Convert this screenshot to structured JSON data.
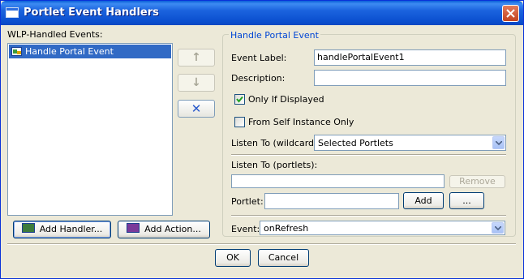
{
  "window": {
    "title": "Portlet Event Handlers"
  },
  "left": {
    "label": "WLP-Handled Events:",
    "events": [
      "Handle Portal Event"
    ],
    "add_handler": "Add Handler...",
    "add_action": "Add Action..."
  },
  "middle": {
    "up_icon": "up-arrow-icon",
    "down_icon": "down-arrow-icon",
    "delete_icon": "delete-x-icon"
  },
  "group": {
    "title": "Handle Portal Event",
    "event_label_label": "Event Label:",
    "event_label_value": "handlePortalEvent1",
    "description_label": "Description:",
    "description_value": "",
    "only_if_displayed": {
      "label": "Only If Displayed",
      "checked": true
    },
    "from_self": {
      "label": "From Self Instance Only",
      "checked": false
    },
    "listen_wildcard_label": "Listen To (wildcard):",
    "listen_wildcard_value": "Selected Portlets",
    "listen_portlets_label": "Listen To (portlets):",
    "listen_portlets_value": "",
    "remove_label": "Remove",
    "portlet_label": "Portlet:",
    "portlet_value": "",
    "add_label": "Add",
    "browse_label": "...",
    "event_label": "Event:",
    "event_value": "onRefresh"
  },
  "footer": {
    "ok": "OK",
    "cancel": "Cancel"
  },
  "colors": {
    "title_bar": "#0A4FCF",
    "selection": "#316AC5",
    "group_title": "#0046D5",
    "dialog_bg": "#ECE9D8"
  }
}
